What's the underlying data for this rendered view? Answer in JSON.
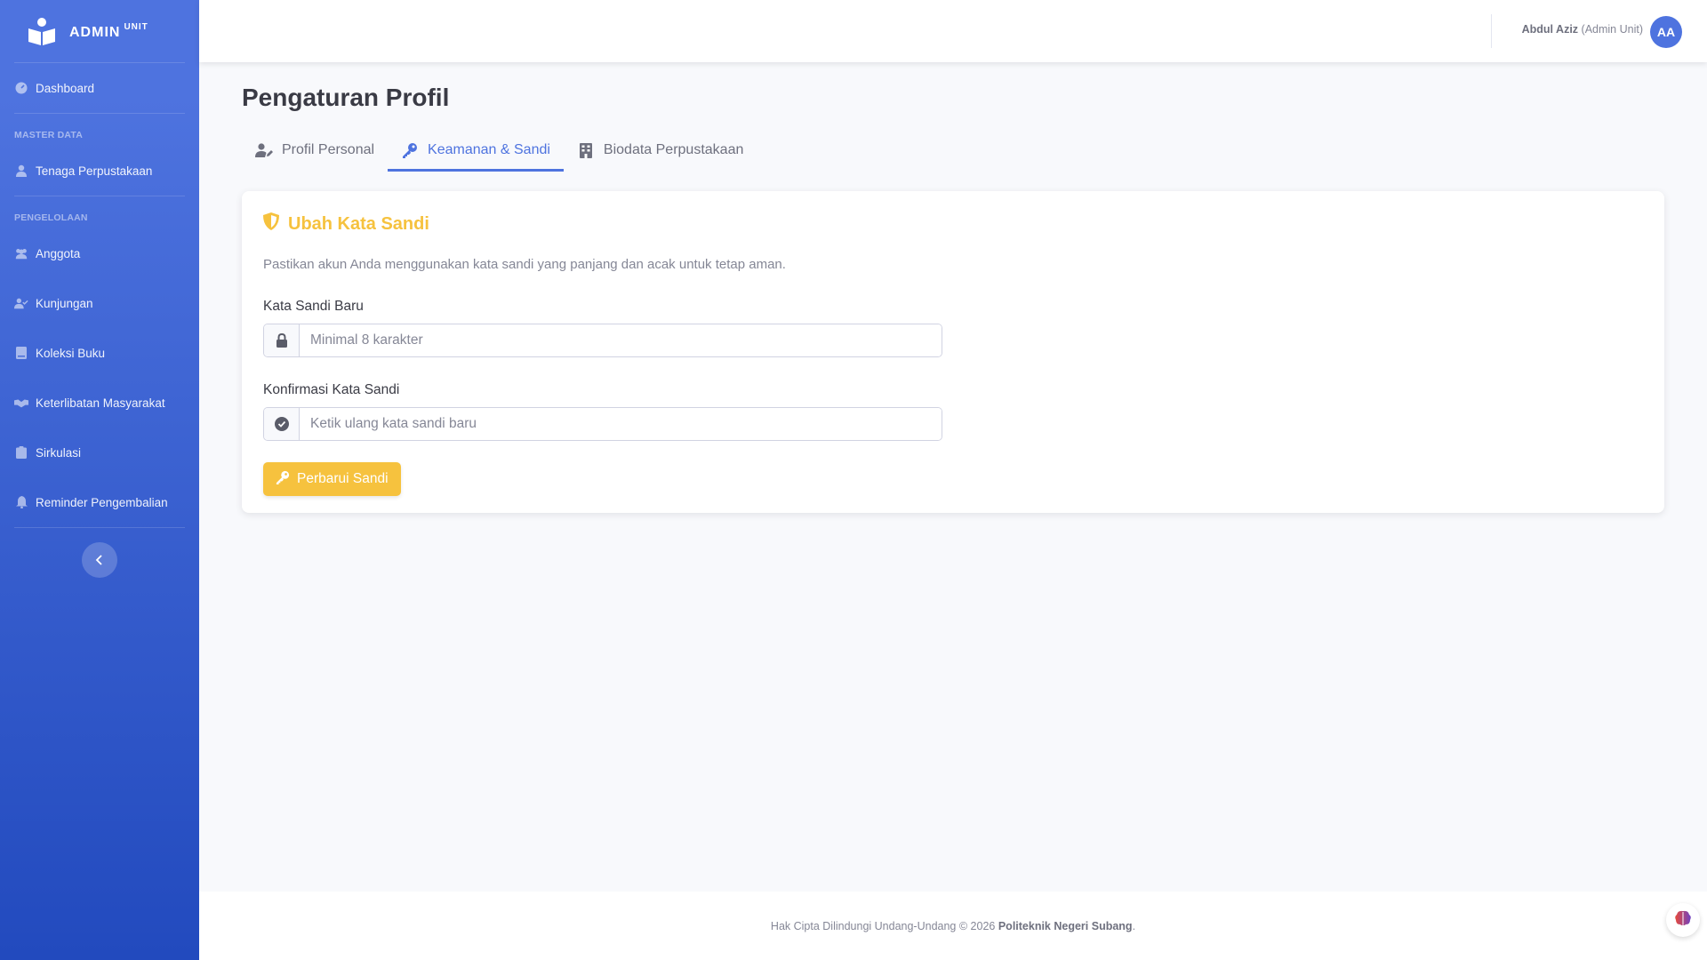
{
  "brand": {
    "name": "ADMIN",
    "sup": "UNIT"
  },
  "sidebar": {
    "dashboard": "Dashboard",
    "heading_master": "MASTER DATA",
    "tenaga": "Tenaga Perpustakaan",
    "heading_pengelolaan": "PENGELOLAAN",
    "items": [
      {
        "label": "Anggota",
        "icon": "users-icon"
      },
      {
        "label": "Kunjungan",
        "icon": "user-check-icon"
      },
      {
        "label": "Koleksi Buku",
        "icon": "book-icon"
      },
      {
        "label": "Keterlibatan Masyarakat",
        "icon": "handshake-icon"
      },
      {
        "label": "Sirkulasi",
        "icon": "clipboard-icon"
      },
      {
        "label": "Reminder Pengembalian",
        "icon": "bell-icon"
      }
    ]
  },
  "topbar": {
    "user_name": "Abdul Aziz",
    "user_role": "(Admin Unit)",
    "avatar_initials": "AA"
  },
  "page": {
    "title": "Pengaturan Profil"
  },
  "tabs": [
    {
      "label": "Profil Personal",
      "active": false
    },
    {
      "label": "Keamanan & Sandi",
      "active": true
    },
    {
      "label": "Biodata Perpustakaan",
      "active": false
    }
  ],
  "card": {
    "title": "Ubah Kata Sandi",
    "description": "Pastikan akun Anda menggunakan kata sandi yang panjang dan acak untuk tetap aman.",
    "new_password_label": "Kata Sandi Baru",
    "new_password_placeholder": "Minimal 8 karakter",
    "confirm_label": "Konfirmasi Kata Sandi",
    "confirm_placeholder": "Ketik ulang kata sandi baru",
    "submit_label": "Perbarui Sandi"
  },
  "footer": {
    "text": "Hak Cipta Dilindungi Undang-Undang © 2026",
    "org": "Politeknik Negeri Subang",
    "end": "."
  },
  "colors": {
    "primary": "#4e73df",
    "warning": "#f6c23e"
  }
}
